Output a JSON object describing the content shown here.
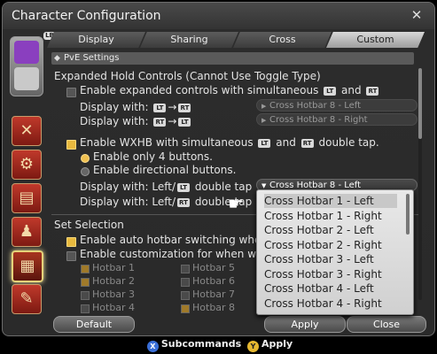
{
  "window": {
    "title": "Character Configuration",
    "close_icon": "gear-close-icon"
  },
  "tabs": [
    {
      "label": "Display"
    },
    {
      "label": "Sharing"
    },
    {
      "label": "Cross"
    },
    {
      "label": "Custom"
    }
  ],
  "section": {
    "title": "PvE Settings"
  },
  "expanded": {
    "heading": "Expanded Hold Controls (Cannot Use Toggle Type)",
    "enable_prefix": "Enable expanded controls with simultaneous",
    "and": "and",
    "display_with": "Display with:",
    "dd1": "Cross Hotbar 8 - Left",
    "dd2": "Cross Hotbar 8 - Right"
  },
  "wxhb": {
    "enable_prefix": "Enable WXHB with simultaneous",
    "and": "and",
    "suffix": "double tap.",
    "opt1": "Enable only 4 buttons.",
    "opt2": "Enable directional buttons.",
    "dw_left": "Display with: Left/",
    "double_tap": "double tap",
    "dd_active": "Cross Hotbar 8 - Left"
  },
  "set_selection": {
    "heading": "Set Selection",
    "auto": "Enable auto hotbar switching when dr",
    "custom": "Enable customization for when weapo"
  },
  "hotbars": {
    "col1": [
      "Hotbar 1",
      "Hotbar 2",
      "Hotbar 3",
      "Hotbar 4"
    ],
    "col2": [
      "Hotbar 5",
      "Hotbar 6",
      "Hotbar 7",
      "Hotbar 8"
    ]
  },
  "keys": {
    "lt": "LT",
    "rt": "RT",
    "arrow": "→"
  },
  "dropdown_list": [
    "Cross Hotbar 1 - Left",
    "Cross Hotbar 1 - Right",
    "Cross Hotbar 2 - Left",
    "Cross Hotbar 2 - Right",
    "Cross Hotbar 3 - Left",
    "Cross Hotbar 3 - Right",
    "Cross Hotbar 4 - Left",
    "Cross Hotbar 4 - Right"
  ],
  "buttons": {
    "default": "Default",
    "apply": "Apply",
    "close": "Close"
  },
  "footer": {
    "x": "X",
    "subcommands": "Subcommands",
    "y": "Y",
    "apply": "Apply"
  },
  "colors": {
    "accent": "#e8b93e",
    "tab_active": "#d8d8d8"
  }
}
